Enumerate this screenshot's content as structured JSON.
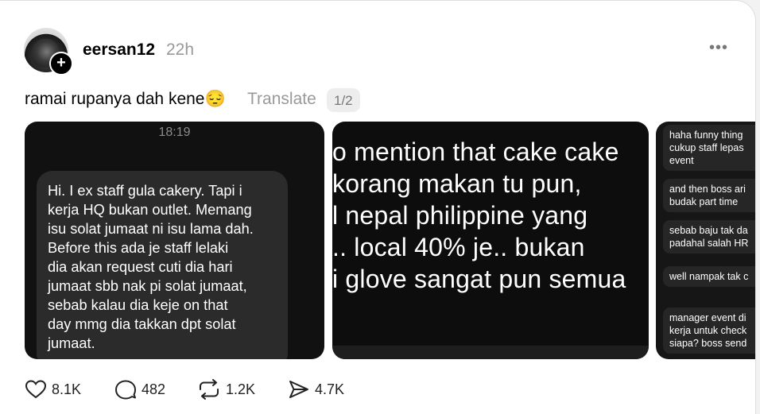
{
  "post": {
    "username": "eersan12",
    "timestamp": "22h",
    "more_icon": "•••",
    "caption": "ramai rupanya dah kene😔",
    "translate_label": "Translate",
    "page_indicator": "1/2"
  },
  "media": {
    "image1": {
      "time": "18:19",
      "bubble_lines": [
        "Hi. I ex staff gula cakery. Tapi i",
        "kerja HQ bukan outlet. Memang",
        "isu solat jumaat ni isu lama dah.",
        "Before this ada je staff lelaki",
        "dia akan request cuti dia hari",
        "jumaat sbb nak pi solat jumaat,",
        "sebab kalau dia keje on that",
        "day mmg dia takkan dpt solat",
        "jumaat."
      ]
    },
    "image2": {
      "lines": [
        "o mention that cake cake",
        "korang makan tu pun,",
        "l nepal philippine yang",
        ".. local 40% je.. bukan",
        "i glove sangat pun semua"
      ]
    },
    "image3": {
      "messages": [
        [
          "haha funny thing",
          "cukup staff lepas",
          "event"
        ],
        [
          "and then boss ari",
          "budak part time"
        ],
        [
          "sebab baju tak da",
          "padahal salah HR"
        ],
        [
          "well nampak tak c"
        ],
        [
          "manager event di",
          "kerja untuk check",
          "siapa? boss send"
        ]
      ]
    }
  },
  "actions": {
    "likes": "8.1K",
    "comments": "482",
    "reposts": "1.2K",
    "shares": "4.7K"
  },
  "icons": {
    "follow": "+",
    "like": "heart-icon",
    "comment": "comment-bubble-icon",
    "repost": "repost-icon",
    "share": "send-icon"
  }
}
